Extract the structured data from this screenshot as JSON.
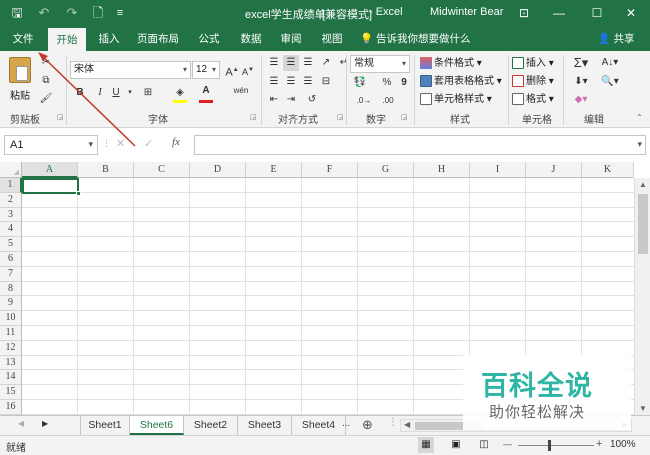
{
  "titlebar": {
    "doc_title": "excel学生成绩单",
    "mode": "[兼容模式]",
    "app": "- Excel",
    "user": "Midwinter Bear",
    "save_glyph": "🖫",
    "undo_glyph": "↶",
    "redo_glyph": "↷",
    "new_glyph": "🗋",
    "customize_glyph": "≡",
    "ribbon_opts_glyph": "⊡",
    "minimize_glyph": "—",
    "maximize_glyph": "☐",
    "close_glyph": "✕"
  },
  "tabs": [
    "文件",
    "开始",
    "插入",
    "页面布局",
    "公式",
    "数据",
    "审阅",
    "视图"
  ],
  "tell_me": "告诉我你想要做什么",
  "share": "共享",
  "ribbon": {
    "clipboard": {
      "paste": "粘贴",
      "label": "剪贴板"
    },
    "font": {
      "name": "宋体",
      "size": "12",
      "bold": "B",
      "italic": "I",
      "underline": "U",
      "grow": "A",
      "shrink": "A",
      "font_color_letter": "A",
      "wen": "wén",
      "label": "字体"
    },
    "alignment": {
      "label": "对齐方式"
    },
    "number": {
      "format": "常规",
      "percent": "%",
      "comma": "9",
      "label": "数字"
    },
    "styles": {
      "conditional": "条件格式",
      "table": "套用表格格式",
      "cell": "单元格样式",
      "label": "样式"
    },
    "cells": {
      "insert": "插入",
      "delete": "删除",
      "format": "格式",
      "label": "单元格"
    },
    "editing": {
      "label": "编辑"
    }
  },
  "formula_bar": {
    "name_box": "A1",
    "cancel": "✕",
    "enter": "✓",
    "fx": "fx",
    "formula": ""
  },
  "grid": {
    "columns": [
      "A",
      "B",
      "C",
      "D",
      "E",
      "F",
      "G",
      "H",
      "I",
      "J",
      "K"
    ],
    "rows": [
      "1",
      "2",
      "3",
      "4",
      "5",
      "6",
      "7",
      "8",
      "9",
      "10",
      "11",
      "12",
      "13",
      "14",
      "15",
      "16"
    ],
    "active_cell": "A1"
  },
  "sheets": {
    "tabs": [
      "Sheet1",
      "Sheet6",
      "Sheet2",
      "Sheet3",
      "Sheet4"
    ],
    "active": "Sheet6",
    "more": "...",
    "add": "⊕"
  },
  "status": {
    "ready": "就绪",
    "zoom": "100%",
    "minus": "—",
    "plus": "+"
  },
  "watermark": {
    "line1": "百科全说",
    "line2": "助你轻松解决"
  },
  "colors": {
    "accent": "#217346",
    "annotation": "#c0392b"
  }
}
